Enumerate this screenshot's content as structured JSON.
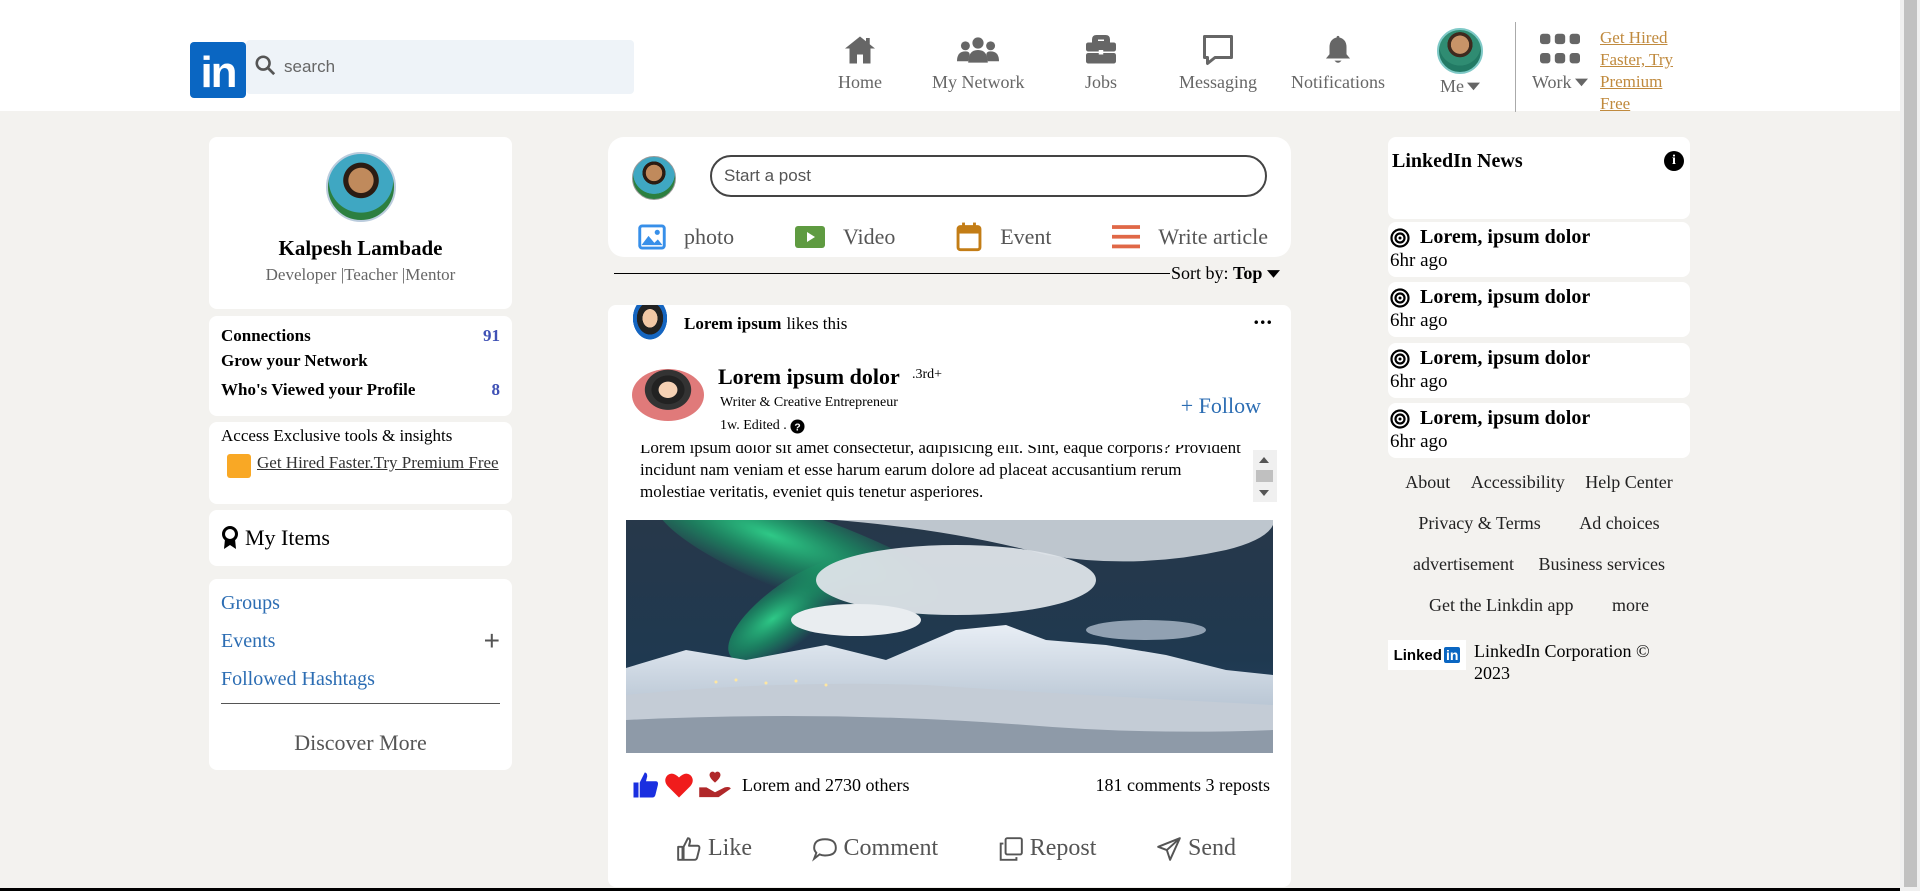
{
  "header": {
    "logo_text": "in",
    "search_placeholder": "search",
    "nav": [
      {
        "label": "Home",
        "icon": "home-icon"
      },
      {
        "label": "My Network",
        "icon": "network-icon"
      },
      {
        "label": "Jobs",
        "icon": "briefcase-icon"
      },
      {
        "label": "Messaging",
        "icon": "message-icon"
      },
      {
        "label": "Notifications",
        "icon": "bell-icon"
      },
      {
        "label": "Me",
        "icon": "avatar"
      },
      {
        "label": "Work",
        "icon": "grid-icon"
      }
    ],
    "premium_link": "Get Hired Faster, Try Premium Free"
  },
  "profile": {
    "name": "Kalpesh Lambade",
    "title": "Developer |Teacher |Mentor",
    "connections_label": "Connections",
    "connections_count": "91",
    "grow_label": "Grow your Network",
    "viewed_label": "Who's Viewed your Profile",
    "viewed_count": "8",
    "access_title": "Access Exclusive tools & insights",
    "access_link": "Get Hired Faster.Try Premium Free",
    "my_items": "My Items",
    "groups": "Groups",
    "events": "Events",
    "hashtags": "Followed Hashtags",
    "discover": "Discover More"
  },
  "composer": {
    "placeholder": "Start a post",
    "actions": [
      {
        "label": "photo",
        "icon": "photo-icon",
        "color": "#378fe9"
      },
      {
        "label": "Video",
        "icon": "video-icon",
        "color": "#5f9b41"
      },
      {
        "label": "Event",
        "icon": "calendar-icon",
        "color": "#c37d16"
      },
      {
        "label": "Write article",
        "icon": "article-icon",
        "color": "#e06847"
      }
    ],
    "sort_label": "Sort by:",
    "sort_value": "Top"
  },
  "post": {
    "liker_name": "Lorem ipsum",
    "liker_text": "likes this",
    "author": "Lorem ipsum dolor",
    "degree": ".3rd+",
    "subtitle": "Writer & Creative Entrepreneur",
    "time": "1w. Edited .",
    "follow": "+ Follow",
    "text": "Lorem ipsum dolor sit amet consectetur, adipisicing elit. Sint, eaque corporis? Provident incidunt nam veniam et esse harum earum dolore ad placeat accusantium rerum molestiae veritatis, eveniet quis tenetur asperiores.",
    "reactions_text": "Lorem and 2730 others",
    "comments_text": "181 comments 3 reposts",
    "actions": [
      {
        "label": "Like",
        "icon": "like-icon"
      },
      {
        "label": "Comment",
        "icon": "comment-icon"
      },
      {
        "label": "Repost",
        "icon": "repost-icon"
      },
      {
        "label": "Send",
        "icon": "send-icon"
      }
    ]
  },
  "news": {
    "title": "LinkedIn News",
    "items": [
      {
        "headline": "Lorem, ipsum dolor",
        "ago": "6hr ago"
      },
      {
        "headline": "Lorem, ipsum dolor",
        "ago": "6hr ago"
      },
      {
        "headline": "Lorem, ipsum dolor",
        "ago": "6hr ago"
      },
      {
        "headline": "Lorem, ipsum dolor",
        "ago": "6hr ago"
      }
    ],
    "footer": [
      "About",
      "Accessibility",
      "Help Center",
      "Privacy & Terms",
      "Ad choices",
      "advertisement",
      "Business services",
      "Get the Linkdin app",
      "more"
    ],
    "corp_logo": "Linked",
    "corp_logo_in": "in",
    "corp_text": "LinkedIn Corporation © 2023"
  },
  "colors": {
    "brand": "#0a66c2",
    "link": "#2c6db3",
    "premium": "#c08a3e",
    "count": "#3f51b5"
  }
}
